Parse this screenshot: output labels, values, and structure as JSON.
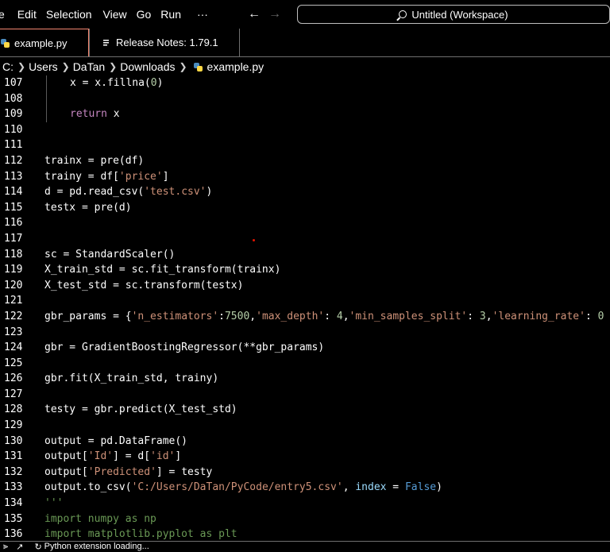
{
  "menu": {
    "items": [
      "e",
      "Edit",
      "Selection",
      "View",
      "Go",
      "Run",
      "···"
    ]
  },
  "nav": {
    "back": "←",
    "forward": "→"
  },
  "command_center": {
    "label": "Untitled (Workspace)"
  },
  "tabs": [
    {
      "label": "example.py",
      "icon": "python-file-icon",
      "active": true
    },
    {
      "label": "Release Notes: 1.79.1",
      "icon": "document-icon",
      "active": false
    }
  ],
  "breadcrumb": {
    "items": [
      "C:",
      "Users",
      "DaTan",
      "Downloads",
      "example.py"
    ]
  },
  "editor": {
    "lines": [
      {
        "num": "107",
        "indent": true,
        "code": "x = x.fillna(0)"
      },
      {
        "num": "108",
        "indent": true,
        "code": ""
      },
      {
        "num": "109",
        "indent": true,
        "code": "return x"
      },
      {
        "num": "110",
        "indent": false,
        "code": ""
      },
      {
        "num": "111",
        "indent": false,
        "code": ""
      },
      {
        "num": "112",
        "indent": false,
        "code": "trainx = pre(df)"
      },
      {
        "num": "113",
        "indent": false,
        "code": "trainy = df['price']"
      },
      {
        "num": "114",
        "indent": false,
        "code": "d = pd.read_csv('test.csv')"
      },
      {
        "num": "115",
        "indent": false,
        "code": "testx = pre(d)"
      },
      {
        "num": "116",
        "indent": false,
        "code": ""
      },
      {
        "num": "117",
        "indent": false,
        "code": ""
      },
      {
        "num": "118",
        "indent": false,
        "code": "sc = StandardScaler()"
      },
      {
        "num": "119",
        "indent": false,
        "code": "X_train_std = sc.fit_transform(trainx)"
      },
      {
        "num": "120",
        "indent": false,
        "code": "X_test_std = sc.transform(testx)"
      },
      {
        "num": "121",
        "indent": false,
        "code": ""
      },
      {
        "num": "122",
        "indent": false,
        "code": "gbr_params = {'n_estimators':7500,'max_depth': 4,'min_samples_split': 3,'learning_rate': 0"
      },
      {
        "num": "123",
        "indent": false,
        "code": ""
      },
      {
        "num": "124",
        "indent": false,
        "code": "gbr = GradientBoostingRegressor(**gbr_params)"
      },
      {
        "num": "125",
        "indent": false,
        "code": ""
      },
      {
        "num": "126",
        "indent": false,
        "code": "gbr.fit(X_train_std, trainy)"
      },
      {
        "num": "127",
        "indent": false,
        "code": ""
      },
      {
        "num": "128",
        "indent": false,
        "code": "testy = gbr.predict(X_test_std)"
      },
      {
        "num": "129",
        "indent": false,
        "code": ""
      },
      {
        "num": "130",
        "indent": false,
        "code": "output = pd.DataFrame()"
      },
      {
        "num": "131",
        "indent": false,
        "code": "output['Id'] = d['id']"
      },
      {
        "num": "132",
        "indent": false,
        "code": "output['Predicted'] = testy"
      },
      {
        "num": "133",
        "indent": false,
        "code": "output.to_csv('C:/Users/DaTan/PyCode/entry5.csv', index = False)"
      },
      {
        "num": "134",
        "indent": false,
        "code": "'''"
      },
      {
        "num": "135",
        "indent": false,
        "code": "import numpy as np"
      },
      {
        "num": "136",
        "indent": false,
        "code": "import matplotlib.pyplot as plt"
      }
    ]
  },
  "status": {
    "text": "Python extension loading..."
  }
}
